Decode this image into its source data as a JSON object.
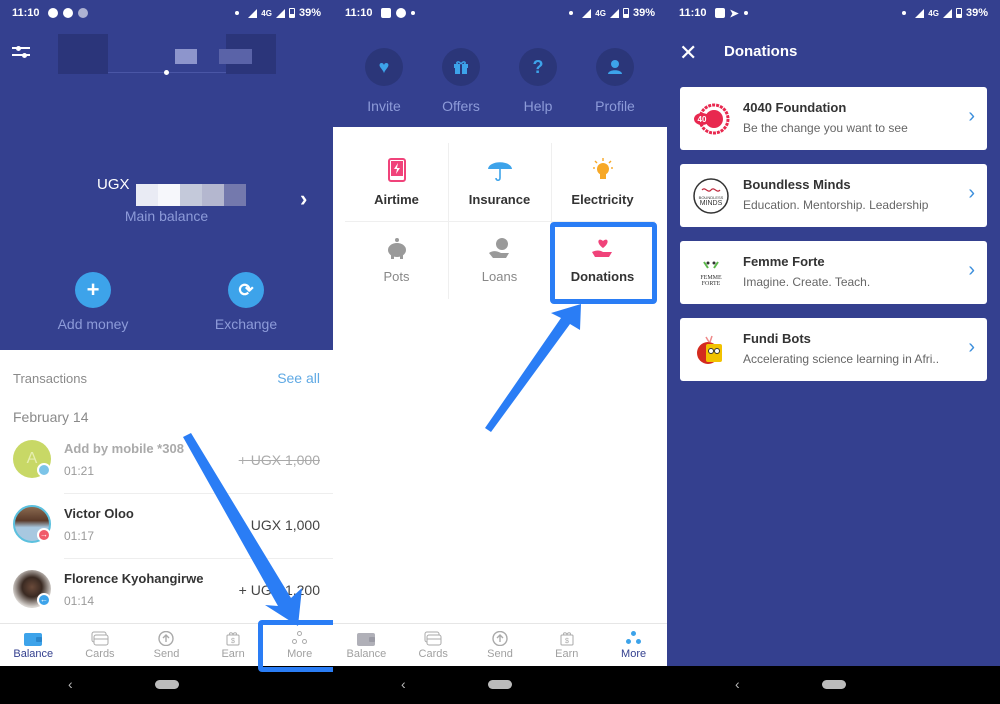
{
  "status_bar": {
    "time": "11:10",
    "network": "4G",
    "battery": "39%"
  },
  "screen1": {
    "currency": "UGX",
    "main_balance_label": "Main balance",
    "actions": [
      {
        "label": "Add money",
        "icon": "plus-icon"
      },
      {
        "label": "Exchange",
        "icon": "exchange-icon"
      }
    ],
    "transactions_title": "Transactions",
    "see_all": "See all",
    "date_header": "February 14",
    "transactions": [
      {
        "name": "Add by mobile *308",
        "time": "01:21",
        "amount": "+ UGX 1,000",
        "status": "cancelled",
        "avatar_initial": "A",
        "avatar_color": "#c8d866"
      },
      {
        "name": "Victor Oloo",
        "time": "01:17",
        "amount": "- UGX 1,000",
        "status": "sent"
      },
      {
        "name": "Florence Kyohangirwe",
        "time": "01:14",
        "amount": "+ UGX 1,200",
        "status": "received"
      }
    ],
    "tabs": [
      {
        "label": "Balance",
        "icon": "wallet-icon",
        "active": true
      },
      {
        "label": "Cards",
        "icon": "cards-icon",
        "active": false
      },
      {
        "label": "Send",
        "icon": "send-icon",
        "active": false
      },
      {
        "label": "Earn",
        "icon": "gift-dollar-icon",
        "active": false
      },
      {
        "label": "More",
        "icon": "more-dots-icon",
        "active": false
      }
    ]
  },
  "screen2": {
    "quick_actions": [
      {
        "label": "Invite",
        "icon": "heart-icon"
      },
      {
        "label": "Offers",
        "icon": "gift-icon"
      },
      {
        "label": "Help",
        "icon": "question-icon"
      },
      {
        "label": "Profile",
        "icon": "profile-icon"
      }
    ],
    "services": [
      {
        "label": "Airtime",
        "icon": "phone-lightning-icon",
        "color": "#f0437a"
      },
      {
        "label": "Insurance",
        "icon": "umbrella-icon",
        "color": "#3da3ea"
      },
      {
        "label": "Electricity",
        "icon": "lightbulb-icon",
        "color": "#f7a826"
      },
      {
        "label": "Pots",
        "icon": "piggy-bank-icon",
        "color": "#9a9a9a"
      },
      {
        "label": "Loans",
        "icon": "hand-coin-icon",
        "color": "#9a9a9a"
      },
      {
        "label": "Donations",
        "icon": "hand-heart-icon",
        "color": "#f0437a"
      }
    ],
    "tabs": [
      {
        "label": "Balance",
        "icon": "wallet-icon",
        "active": false
      },
      {
        "label": "Cards",
        "icon": "cards-icon",
        "active": false
      },
      {
        "label": "Send",
        "icon": "send-icon",
        "active": false
      },
      {
        "label": "Earn",
        "icon": "gift-dollar-icon",
        "active": false
      },
      {
        "label": "More",
        "icon": "more-dots-icon",
        "active": true
      }
    ]
  },
  "screen3": {
    "title": "Donations",
    "organizations": [
      {
        "name": "4040 Foundation",
        "tagline": "Be the change you want to see",
        "logo_color": "#e8284f"
      },
      {
        "name": "Boundless Minds",
        "tagline": "Education. Mentorship. Leadership",
        "logo_color": "#333333"
      },
      {
        "name": "Femme Forte",
        "tagline": "Imagine. Create. Teach.",
        "logo_color": "#5cb84a"
      },
      {
        "name": "Fundi Bots",
        "tagline": "Accelerating science learning in Afri..",
        "logo_color": "#f2c200"
      }
    ]
  },
  "annotation_color": "#2a7df5"
}
